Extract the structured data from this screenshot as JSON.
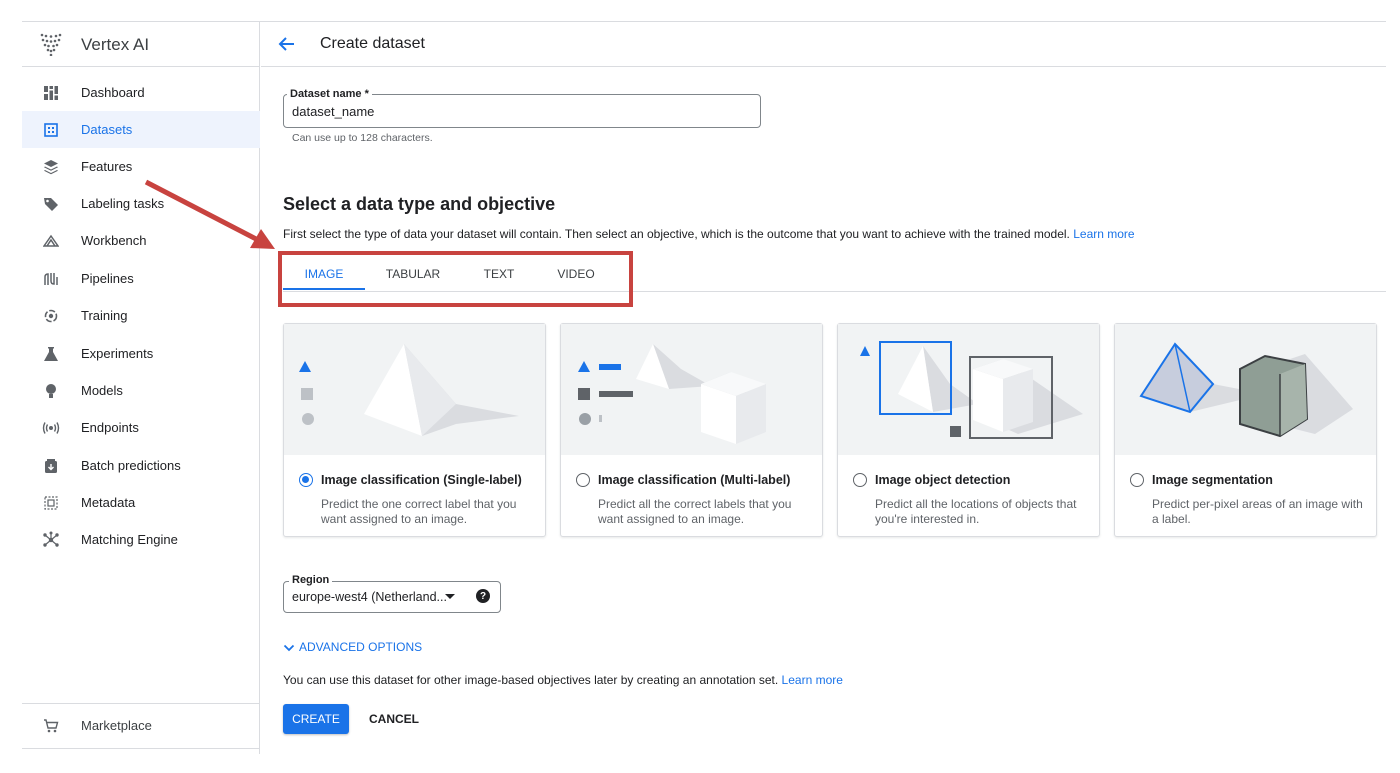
{
  "app": {
    "name": "Vertex AI"
  },
  "sidebar": {
    "items": [
      {
        "label": "Dashboard",
        "icon": "dashboard-icon"
      },
      {
        "label": "Datasets",
        "icon": "datasets-icon",
        "active": true
      },
      {
        "label": "Features",
        "icon": "features-icon"
      },
      {
        "label": "Labeling tasks",
        "icon": "labeling-tasks-icon"
      },
      {
        "label": "Workbench",
        "icon": "workbench-icon"
      },
      {
        "label": "Pipelines",
        "icon": "pipelines-icon"
      },
      {
        "label": "Training",
        "icon": "training-icon"
      },
      {
        "label": "Experiments",
        "icon": "experiments-icon"
      },
      {
        "label": "Models",
        "icon": "models-icon"
      },
      {
        "label": "Endpoints",
        "icon": "endpoints-icon"
      },
      {
        "label": "Batch predictions",
        "icon": "batch-predictions-icon"
      },
      {
        "label": "Metadata",
        "icon": "metadata-icon"
      },
      {
        "label": "Matching Engine",
        "icon": "matching-engine-icon"
      }
    ],
    "marketplace": {
      "label": "Marketplace",
      "icon": "marketplace-cart-icon"
    }
  },
  "header": {
    "title": "Create dataset"
  },
  "form": {
    "dataset_name": {
      "label": "Dataset name *",
      "value": "dataset_name",
      "hint": "Can use up to 128 characters."
    },
    "section_title": "Select a data type and objective",
    "section_desc": "First select the type of data your dataset will contain. Then select an objective, which is the outcome that you want to achieve with the trained model.",
    "learn_more": "Learn more",
    "tabs": [
      {
        "label": "IMAGE",
        "active": true
      },
      {
        "label": "TABULAR"
      },
      {
        "label": "TEXT"
      },
      {
        "label": "VIDEO"
      }
    ],
    "cards": [
      {
        "title": "Image classification (Single-label)",
        "desc": "Predict the one correct label that you want assigned to an image.",
        "selected": true
      },
      {
        "title": "Image classification (Multi-label)",
        "desc": "Predict all the correct labels that you want assigned to an image.",
        "selected": false
      },
      {
        "title": "Image object detection",
        "desc": "Predict all the locations of objects that you're interested in.",
        "selected": false
      },
      {
        "title": "Image segmentation",
        "desc": "Predict per-pixel areas of an image with a label.",
        "selected": false
      }
    ],
    "region": {
      "label": "Region",
      "value": "europe-west4 (Netherland..."
    },
    "advanced_options": "ADVANCED OPTIONS",
    "note": "You can use this dataset for other image-based objectives later by creating an annotation set.",
    "note_link": "Learn more",
    "create_label": "CREATE",
    "cancel_label": "CANCEL"
  },
  "colors": {
    "accent": "#1a73e8",
    "annotation_red": "#c8433f",
    "active_nav_bg": "#eef3fd"
  }
}
